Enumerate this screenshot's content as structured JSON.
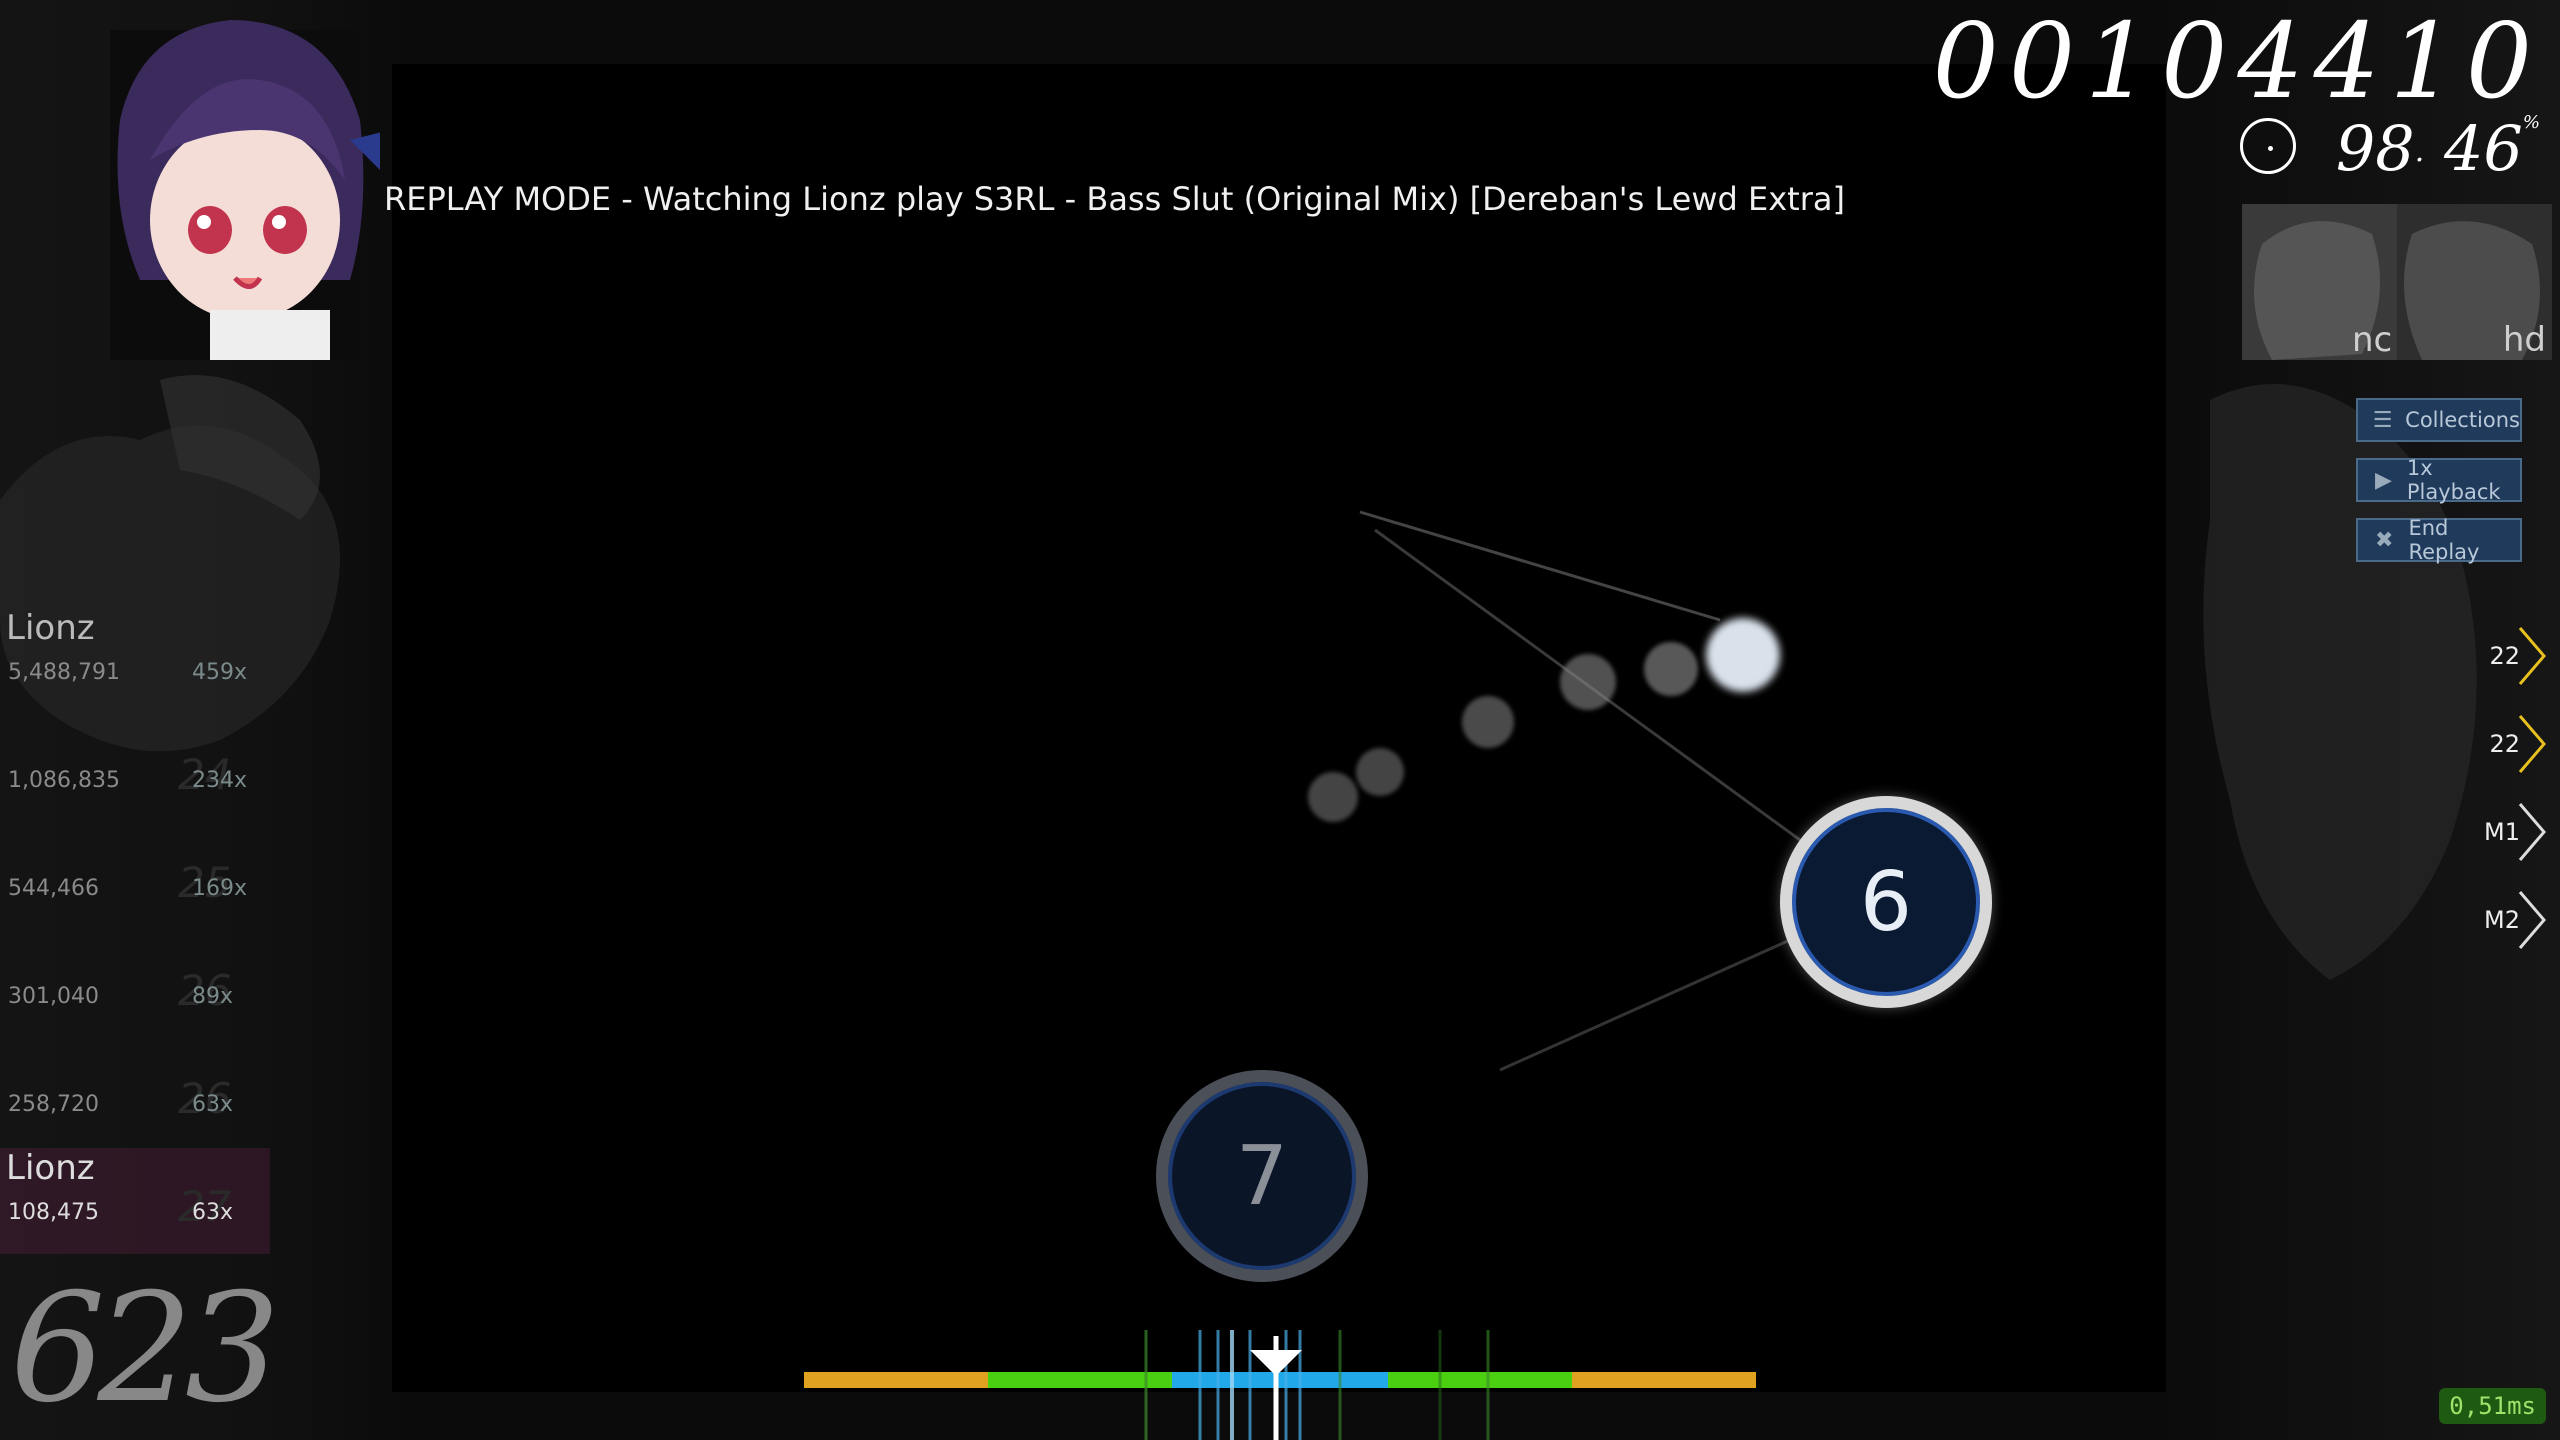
{
  "replay_banner": "REPLAY MODE - Watching Lionz play S3RL - Bass Slut (Original Mix) [Dereban's Lewd Extra]",
  "hud": {
    "score": "00104410",
    "accuracy_whole": "98",
    "accuracy_frac": "46",
    "accuracy_unit": "%",
    "combo": "623",
    "timer_icon": "pie-timer-icon"
  },
  "mods": [
    {
      "label": "nc"
    },
    {
      "label": "hd"
    }
  ],
  "buttons": {
    "collections": "Collections",
    "playback": "1x Playback",
    "end_replay": "End Replay"
  },
  "key_overlay": [
    {
      "label": "22"
    },
    {
      "label": "22"
    },
    {
      "label": "M1"
    },
    {
      "label": "M2"
    }
  ],
  "leaderboard": [
    {
      "name": "Lionz",
      "score": "5,488,791",
      "combo": "459x",
      "rank": ""
    },
    {
      "name": "",
      "score": "1,086,835",
      "combo": "234x",
      "rank": "24"
    },
    {
      "name": "",
      "score": "544,466",
      "combo": "169x",
      "rank": "25"
    },
    {
      "name": "",
      "score": "301,040",
      "combo": "89x",
      "rank": "26"
    },
    {
      "name": "",
      "score": "258,720",
      "combo": "63x",
      "rank": "26"
    },
    {
      "name": "Lionz",
      "score": "108,475",
      "combo": "63x",
      "rank": "27"
    }
  ],
  "hit_objects": [
    {
      "number": "6"
    },
    {
      "number": "7"
    }
  ],
  "hit_error": {
    "colors": {
      "meh": "#e0a020",
      "good": "#4ad010",
      "great": "#20a8e8"
    }
  },
  "frame_time": "0,51ms"
}
